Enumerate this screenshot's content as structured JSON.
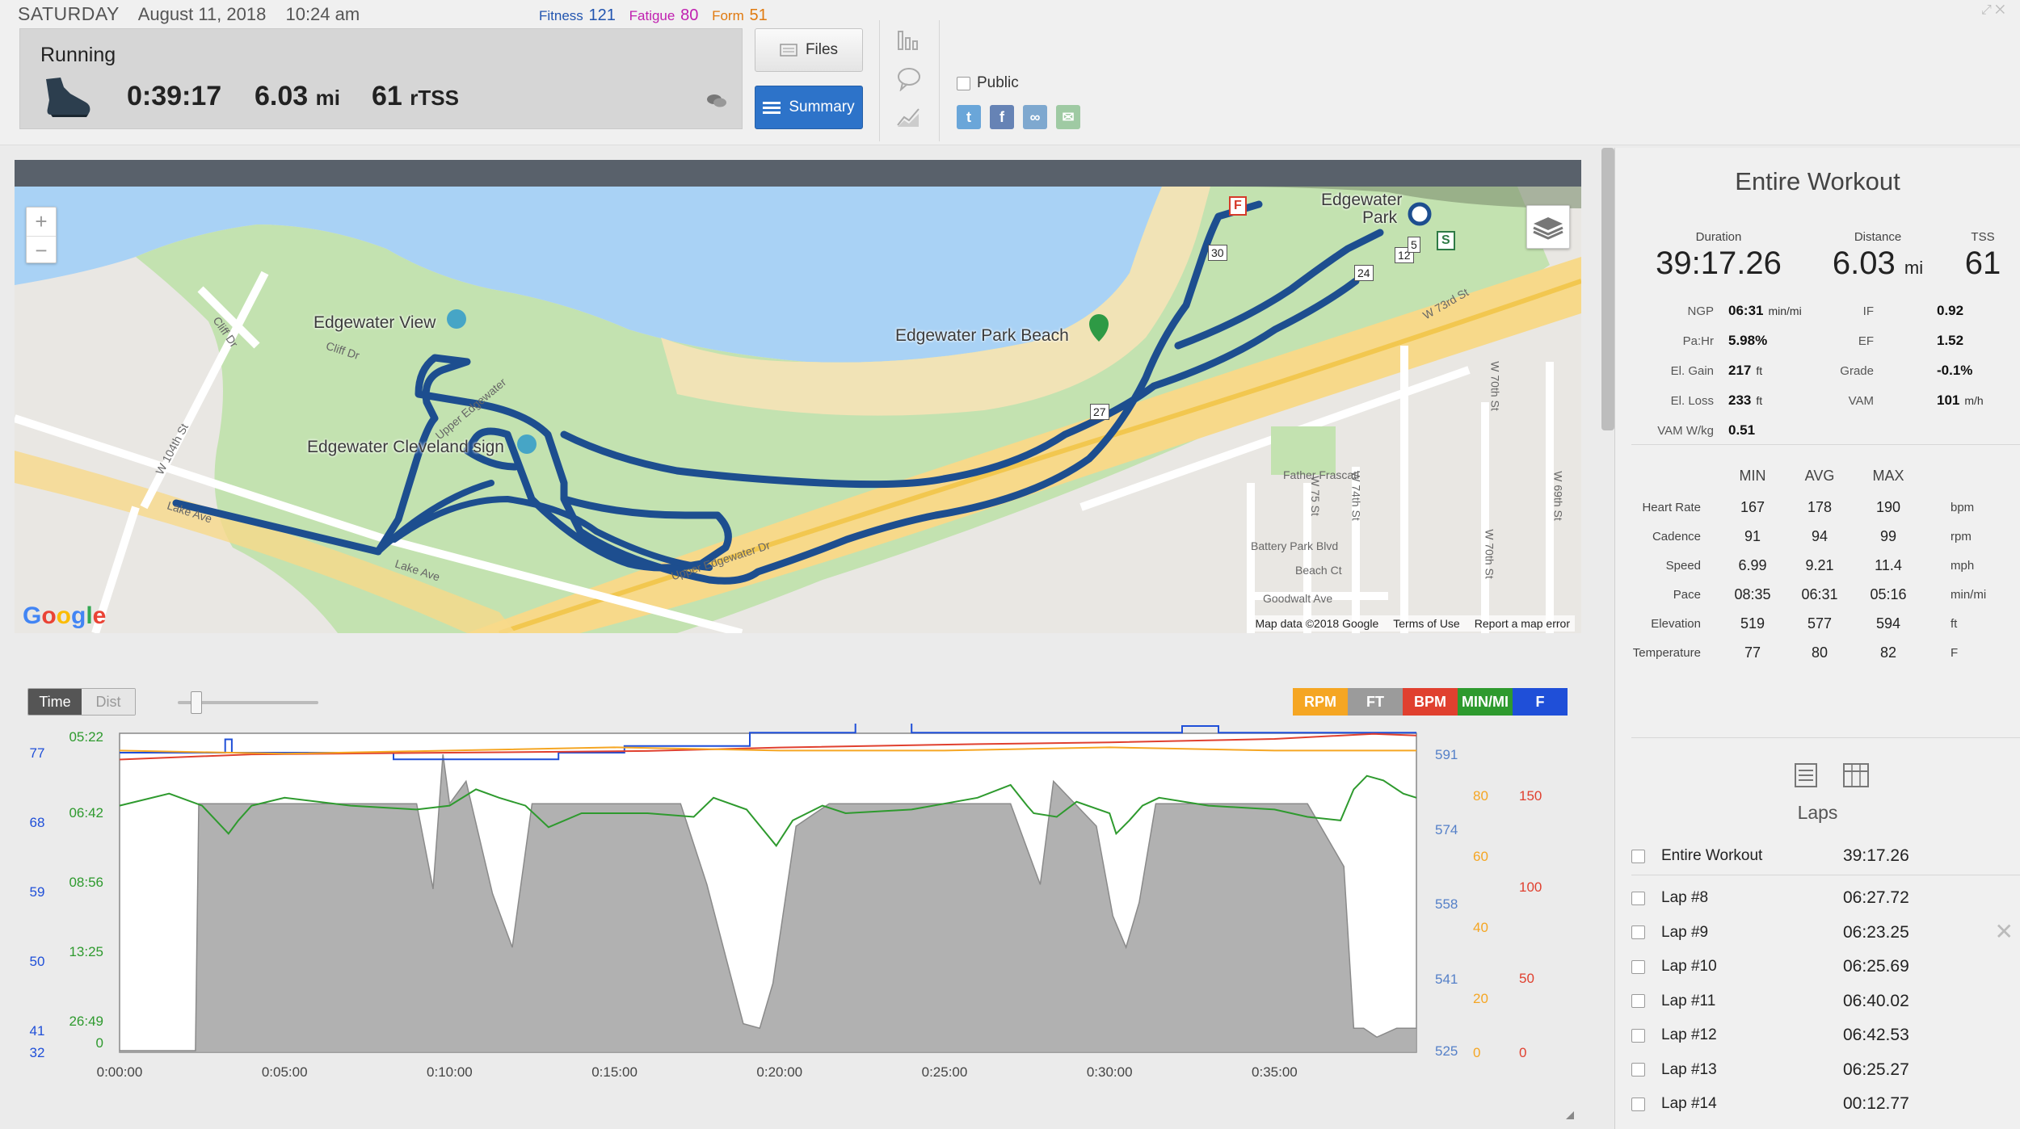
{
  "header": {
    "day": "SATURDAY",
    "date": "August 11, 2018",
    "time": "10:24 am",
    "fitness_label": "Fitness",
    "fitness_value": "121",
    "fatigue_label": "Fatigue",
    "fatigue_value": "80",
    "form_label": "Form",
    "form_value": "51"
  },
  "workout": {
    "type": "Running",
    "duration": "0:39:17",
    "distance": "6.03",
    "distance_unit": "mi",
    "tss": "61",
    "tss_unit": "rTSS"
  },
  "buttons": {
    "files": "Files",
    "summary": "Summary",
    "public": "Public"
  },
  "map": {
    "labels": {
      "edgewater_park_1": "Edgewater",
      "edgewater_park_2": "Park",
      "edgewater_view": "Edgewater View",
      "edgewater_beach": "Edgewater Park Beach",
      "cleveland_sign": "Edgewater Cleveland sign",
      "father_frascati": "Father Frascati",
      "battery_park": "Battery Park Blvd",
      "beach_ct": "Beach Ct",
      "goodwalt": "Goodwalt Ave",
      "cliff_dr_1": "Cliff Dr",
      "cliff_dr_2": "Cliff Dr",
      "w104": "W 104th St",
      "lake_ave_1": "Lake Ave",
      "lake_ave_2": "Lake Ave",
      "w73rd": "W 73rd St",
      "w70th_1": "W 70th St",
      "w70th_2": "W 70th St",
      "w69th": "W 69th St",
      "w75": "W 75 St",
      "w74": "W 74th St",
      "upper_edgewater_1": "Upper Edgewater",
      "upper_edgewater_2": "Upper Edgewater Dr"
    },
    "markers": {
      "m30": "30",
      "m27": "27",
      "m24": "24",
      "m12": "12",
      "m5": "5",
      "start": "S",
      "finish": "F"
    },
    "footer": {
      "copyright": "Map data ©2018 Google",
      "terms": "Terms of Use",
      "report": "Report a map error"
    },
    "google": "Google"
  },
  "chart": {
    "toggle_time": "Time",
    "toggle_dist": "Dist",
    "legend": [
      {
        "label": "RPM",
        "color": "#f5a623"
      },
      {
        "label": "FT",
        "color": "#9b9b9b"
      },
      {
        "label": "BPM",
        "color": "#e0402f"
      },
      {
        "label": "MIN/MI",
        "color": "#2e9a2e"
      },
      {
        "label": "F",
        "color": "#1f4fd8"
      }
    ]
  },
  "chart_data": {
    "type": "line",
    "x_ticks": [
      "0:00:00",
      "0:05:00",
      "0:10:00",
      "0:15:00",
      "0:20:00",
      "0:25:00",
      "0:30:00",
      "0:35:00"
    ],
    "xlim_minutes": [
      0,
      39.3
    ],
    "axes": {
      "temp_f": {
        "ticks": [
          "77",
          "68",
          "59",
          "50",
          "41",
          "32"
        ],
        "color": "#1f4fd8"
      },
      "pace_min_mi": {
        "ticks": [
          "05:22",
          "06:42",
          "08:56",
          "13:25",
          "26:49",
          "0"
        ],
        "color": "#2e9a2e"
      },
      "elevation_ft": {
        "ticks": [
          "591",
          "574",
          "558",
          "541",
          "525"
        ],
        "color": "#5580c8"
      },
      "cadence_rpm": {
        "ticks": [
          "80",
          "60",
          "40",
          "20",
          "0"
        ],
        "color": "#f5a623"
      },
      "heart_rate_bpm": {
        "ticks": [
          "150",
          "100",
          "50",
          "0"
        ],
        "color": "#e0402f"
      }
    },
    "series": [
      {
        "name": "FT",
        "color": "#9b9b9b",
        "x": [
          0,
          2.3,
          2.4,
          6,
          9,
          9.5,
          9.8,
          10,
          10.5,
          11.3,
          11.9,
          12.5,
          13,
          17,
          17.8,
          18.4,
          18.9,
          19.4,
          19.8,
          20.5,
          21.5,
          22,
          27,
          27.9,
          28.3,
          29.6,
          30.1,
          30.5,
          30.9,
          31.4,
          32,
          36,
          37.1,
          37.4,
          37.7,
          38.1,
          38.7,
          39.3
        ],
        "y": [
          525,
          525,
          580,
          580,
          580,
          561,
          591,
          580,
          585,
          560,
          548,
          580,
          580,
          580,
          562,
          545,
          531,
          530,
          540,
          575,
          580,
          580,
          580,
          562,
          585,
          575,
          555,
          548,
          558,
          580,
          580,
          580,
          566,
          530,
          530,
          528,
          530,
          530
        ]
      },
      {
        "name": "MIN/MI",
        "color": "#2e9a2e",
        "x": [
          0,
          1.5,
          2.5,
          3.3,
          3.6,
          4,
          5,
          7,
          9,
          10,
          10.8,
          11.5,
          12.3,
          13,
          14,
          16,
          17.4,
          18,
          19,
          19.9,
          20.4,
          21.3,
          22,
          24,
          26,
          27,
          27.5,
          27.7,
          28.4,
          29,
          30,
          30.2,
          30.6,
          31,
          31.5,
          33,
          35,
          36,
          37,
          37.4,
          37.8,
          38.3,
          38.9,
          39.3
        ],
        "y": [
          "06:20",
          "06:05",
          "06:20",
          "07:00",
          "06:40",
          "06:20",
          "06:10",
          "06:20",
          "06:25",
          "06:20",
          "06:00",
          "06:10",
          "06:20",
          "06:50",
          "06:30",
          "06:30",
          "06:35",
          "06:10",
          "06:25",
          "07:20",
          "06:40",
          "06:20",
          "06:30",
          "06:25",
          "06:10",
          "05:55",
          "06:20",
          "06:30",
          "06:35",
          "06:15",
          "06:30",
          "07:00",
          "06:40",
          "06:20",
          "06:10",
          "06:20",
          "06:25",
          "06:35",
          "06:40",
          "06:00",
          "05:45",
          "05:50",
          "06:05",
          "06:10"
        ]
      },
      {
        "name": "F",
        "color": "#1f4fd8",
        "x": [
          0,
          3,
          3.2,
          3.4,
          3.6,
          8,
          8.3,
          13,
          13.3,
          15,
          15.3,
          18.8,
          19.1,
          22,
          22.3,
          23.5,
          24,
          32,
          32.2,
          33,
          33.3,
          39.3
        ],
        "y": [
          77,
          77,
          79,
          77,
          77,
          77,
          76,
          76,
          77,
          77,
          78,
          78,
          80,
          80,
          82,
          82,
          80,
          80,
          81,
          81,
          80,
          80
        ]
      },
      {
        "name": "BPM",
        "color": "#e0402f",
        "x": [
          0,
          4,
          10,
          16,
          20,
          26,
          30,
          35,
          38,
          39.3
        ],
        "y": [
          171,
          174,
          175,
          176,
          178,
          180,
          181,
          183,
          186,
          185
        ]
      },
      {
        "name": "RPM",
        "color": "#f5a623",
        "x": [
          0,
          5,
          10,
          15,
          20,
          25,
          30,
          35,
          39.3
        ],
        "y": [
          94,
          93,
          94,
          95,
          94,
          94,
          95,
          94,
          94
        ]
      }
    ]
  },
  "summary": {
    "title": "Entire Workout",
    "duration_label": "Duration",
    "duration": "39:17.26",
    "distance_label": "Distance",
    "distance": "6.03",
    "distance_unit": "mi",
    "tss_label": "TSS",
    "tss": "61",
    "left_kv": [
      {
        "label": "NGP",
        "value": "06:31",
        "unit": "min/mi"
      },
      {
        "label": "Pa:Hr",
        "value": "5.98%",
        "unit": ""
      },
      {
        "label": "El. Gain",
        "value": "217",
        "unit": "ft"
      },
      {
        "label": "El. Loss",
        "value": "233",
        "unit": "ft"
      },
      {
        "label": "VAM W/kg",
        "value": "0.51",
        "unit": ""
      }
    ],
    "right_kv": [
      {
        "label": "IF",
        "value": "0.92",
        "unit": ""
      },
      {
        "label": "EF",
        "value": "1.52",
        "unit": ""
      },
      {
        "label": "Grade",
        "value": "-0.1%",
        "unit": ""
      },
      {
        "label": "VAM",
        "value": "101",
        "unit": "m/h"
      }
    ],
    "mm_headers": [
      "MIN",
      "AVG",
      "MAX"
    ],
    "mm_rows": [
      {
        "label": "Heart Rate",
        "min": "167",
        "avg": "178",
        "max": "190",
        "unit": "bpm"
      },
      {
        "label": "Cadence",
        "min": "91",
        "avg": "94",
        "max": "99",
        "unit": "rpm"
      },
      {
        "label": "Speed",
        "min": "6.99",
        "avg": "9.21",
        "max": "11.4",
        "unit": "mph"
      },
      {
        "label": "Pace",
        "min": "08:35",
        "avg": "06:31",
        "max": "05:16",
        "unit": "min/mi"
      },
      {
        "label": "Elevation",
        "min": "519",
        "avg": "577",
        "max": "594",
        "unit": "ft"
      },
      {
        "label": "Temperature",
        "min": "77",
        "avg": "80",
        "max": "82",
        "unit": "F"
      }
    ]
  },
  "laps": {
    "title": "Laps",
    "rows": [
      {
        "name": "Entire Workout",
        "time": "39:17.26"
      },
      {
        "name": "Lap #8",
        "time": "06:27.72"
      },
      {
        "name": "Lap #9",
        "time": "06:23.25"
      },
      {
        "name": "Lap #10",
        "time": "06:25.69"
      },
      {
        "name": "Lap #11",
        "time": "06:40.02"
      },
      {
        "name": "Lap #12",
        "time": "06:42.53"
      },
      {
        "name": "Lap #13",
        "time": "06:25.27"
      },
      {
        "name": "Lap #14",
        "time": "00:12.77"
      }
    ]
  }
}
